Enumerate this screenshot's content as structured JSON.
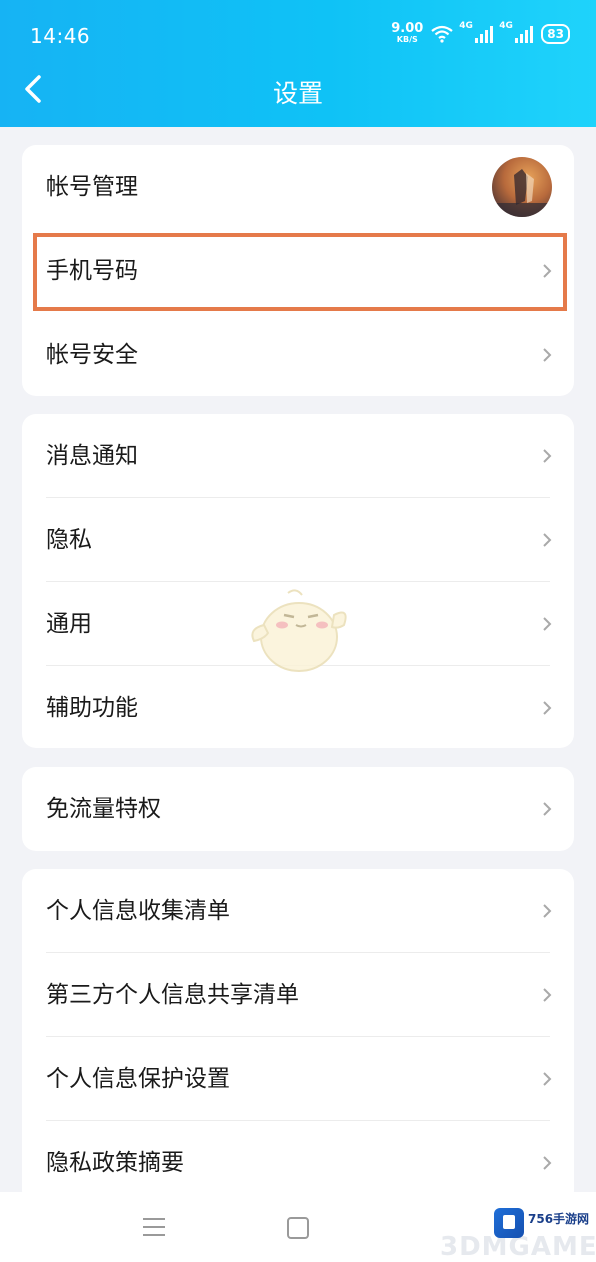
{
  "status_bar": {
    "time": "14:46",
    "net_speed": "9.00",
    "net_unit": "KB/S",
    "sig1_label": "4G",
    "sig2_label": "4G",
    "battery": "83"
  },
  "header": {
    "title": "设置"
  },
  "groups": [
    {
      "items": [
        {
          "label": "帐号管理"
        },
        {
          "label": "手机号码"
        },
        {
          "label": "帐号安全"
        }
      ]
    },
    {
      "items": [
        {
          "label": "消息通知"
        },
        {
          "label": "隐私"
        },
        {
          "label": "通用"
        },
        {
          "label": "辅助功能"
        }
      ]
    },
    {
      "items": [
        {
          "label": "免流量特权"
        }
      ]
    },
    {
      "items": [
        {
          "label": "个人信息收集清单"
        },
        {
          "label": "第三方个人信息共享清单"
        },
        {
          "label": "个人信息保护设置"
        },
        {
          "label": "隐私政策摘要"
        }
      ]
    }
  ],
  "watermark": {
    "site": "756手游网",
    "brand": "3DMGAME"
  },
  "colors": {
    "header_start": "#16b3f4",
    "header_end": "#1fd3fb",
    "highlight": "#e57a4a"
  },
  "icons": {
    "back": "chevron-left-icon",
    "row_arrow": "chevron-right-icon",
    "menu": "menu-icon",
    "home": "home-icon"
  }
}
